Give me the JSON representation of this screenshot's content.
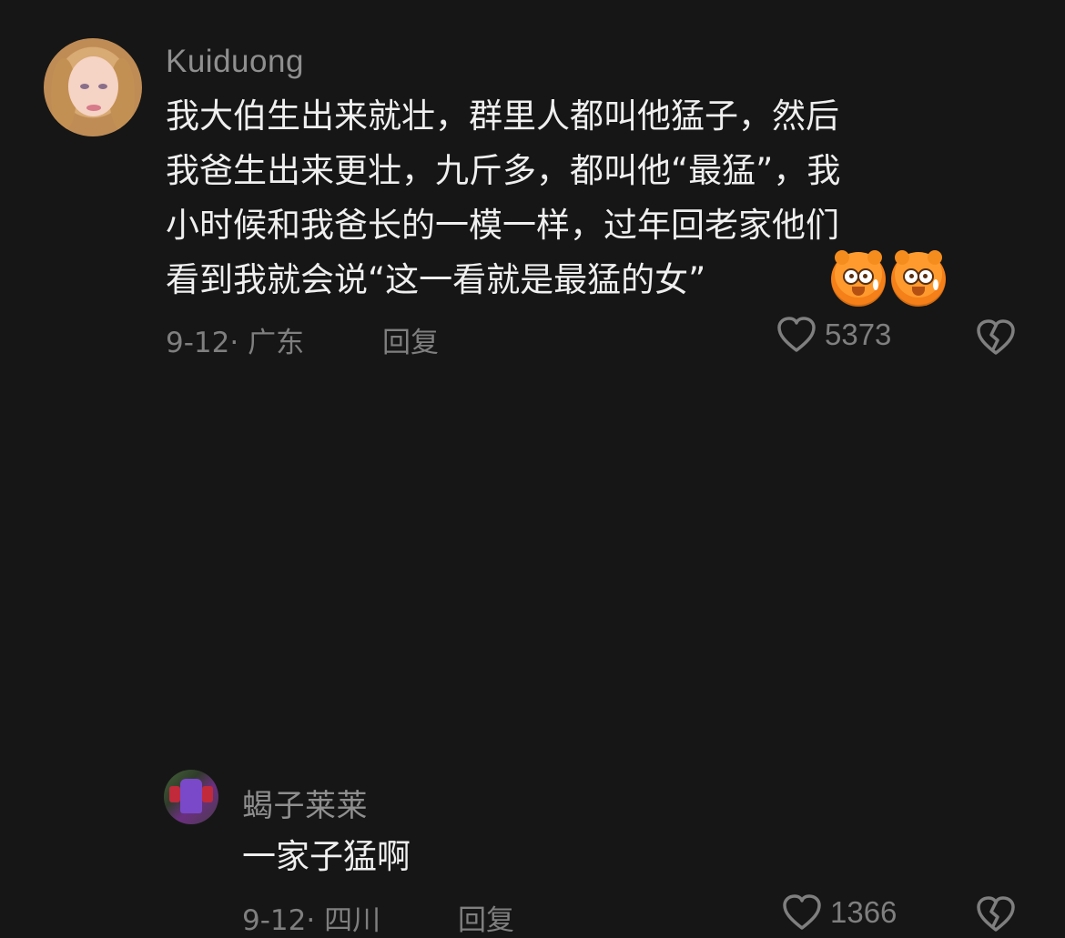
{
  "comments": [
    {
      "username": "Kuiduong",
      "content": "我大伯生出来就壮，群里人都叫他猛子，然后\n我爸生出来更壮，九斤多，都叫他“最猛”，我\n小时候和我爸长的一模一样，过年回老家他们\n看到我就会说“这一看就是最猛的女”",
      "emojis": [
        "bear-icon",
        "bear-icon"
      ],
      "meta": "9-12· 广东",
      "reply_label": "回复",
      "likes": "5373",
      "dislike_icon": "broken-heart-icon"
    },
    {
      "username": "蝎子莱莱",
      "content": "一家子猛啊",
      "meta": "9-12· 四川",
      "reply_label": "回复",
      "likes": "1366",
      "dislike_icon": "broken-heart-icon"
    }
  ],
  "colors": {
    "background": "#161616",
    "text": "#efefef",
    "muted": "#8f8f8f"
  }
}
